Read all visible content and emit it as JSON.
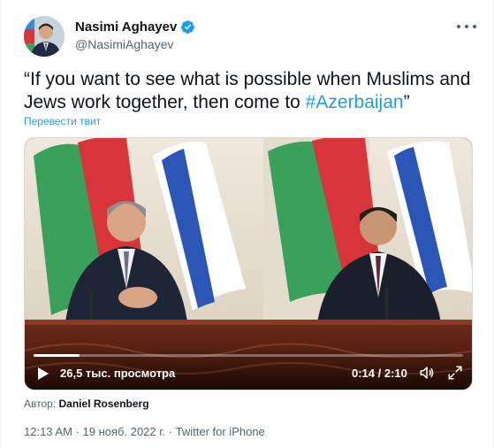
{
  "user": {
    "display_name": "Nasimi Aghayev",
    "handle": "@NasimiAghayev",
    "verified": true
  },
  "tweet": {
    "text_before": "“If you want to see what is possible when Muslims and Jews work together, then come to ",
    "hashtag": "#Azerbaijan",
    "text_after": "”",
    "translate_label": "Перевести твит"
  },
  "video": {
    "views": "26,5 тыс. просмотра",
    "time": "0:14 / 2:10",
    "progress": 0.108
  },
  "author": {
    "label": "Автор:",
    "name": "Daniel Rosenberg"
  },
  "meta": {
    "time": "12:13 AM",
    "date": "19 нояб. 2022 г.",
    "source": "Twitter for iPhone",
    "separator": "·"
  },
  "colors": {
    "accent": "#1d9bf0",
    "text": "#0f1419",
    "muted": "#536471"
  }
}
